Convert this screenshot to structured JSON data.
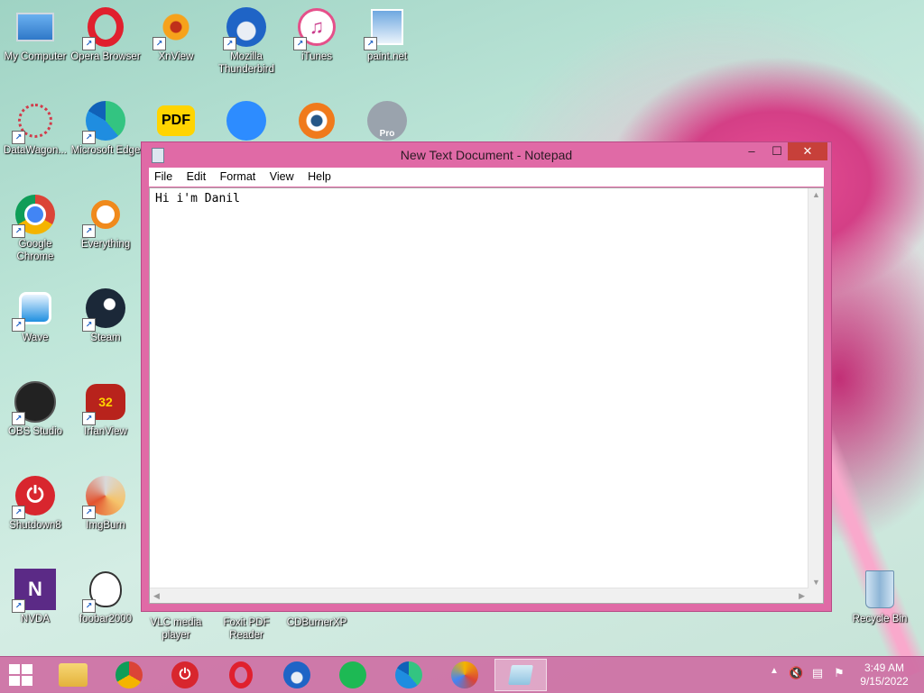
{
  "desktop_icons": [
    {
      "label": "My Computer",
      "icon": "computer-icon"
    },
    {
      "label": "Opera Browser",
      "icon": "opera-icon"
    },
    {
      "label": "XnView",
      "icon": "xnview-icon"
    },
    {
      "label": "Mozilla Thunderbird",
      "icon": "thunderbird-icon"
    },
    {
      "label": "iTunes",
      "icon": "itunes-icon"
    },
    {
      "label": "paint.net",
      "icon": "paintnet-icon"
    },
    {
      "label": "DataWagon...",
      "icon": "datawagon-icon"
    },
    {
      "label": "Microsoft Edge",
      "icon": "edge-icon"
    },
    {
      "label": "",
      "icon": "pdf-icon",
      "badge": "PDF"
    },
    {
      "label": "",
      "icon": "zoom-icon"
    },
    {
      "label": "",
      "icon": "blender-icon"
    },
    {
      "label": "",
      "icon": "google-earth-pro-icon",
      "badge": "Pro"
    },
    {
      "label": "Google Chrome",
      "icon": "chrome-icon"
    },
    {
      "label": "Everything",
      "icon": "everything-search-icon"
    },
    {
      "label": "Wave",
      "icon": "wave-icon"
    },
    {
      "label": "Steam",
      "icon": "steam-icon"
    },
    {
      "label": "OBS Studio",
      "icon": "obs-icon"
    },
    {
      "label": "IrfanView",
      "icon": "irfanview-icon",
      "badge": "32"
    },
    {
      "label": "Shutdown8",
      "icon": "power-icon"
    },
    {
      "label": "ImgBurn",
      "icon": "imgburn-icon"
    },
    {
      "label": "NVDA",
      "icon": "nvda-icon"
    },
    {
      "label": "foobar2000",
      "icon": "foobar-icon"
    },
    {
      "label": "VLC media player",
      "icon": "vlc-icon"
    },
    {
      "label": "Foxit PDF Reader",
      "icon": "foxit-icon"
    },
    {
      "label": "CDBurnerXP",
      "icon": "cdburner-icon"
    },
    {
      "label": "Recycle Bin",
      "icon": "recycle-bin-icon"
    }
  ],
  "window": {
    "title": "New Text Document - Notepad",
    "menu": [
      "File",
      "Edit",
      "Format",
      "View",
      "Help"
    ],
    "content": "Hi i'm Danil",
    "controls": {
      "minimize": "–",
      "maximize": "☐",
      "close": "✕"
    }
  },
  "taskbar": {
    "apps": [
      "file-explorer-icon",
      "chrome-icon",
      "shutdown-icon",
      "opera-icon",
      "thunderbird-icon",
      "spotify-icon",
      "edge-icon",
      "browser-icon",
      "notepad-icon"
    ],
    "time": "3:49 AM",
    "date": "9/15/2022"
  },
  "colors": {
    "window_frame": "#e06aa6",
    "taskbar": "#ce6fa4",
    "close_button": "#c7403a"
  }
}
